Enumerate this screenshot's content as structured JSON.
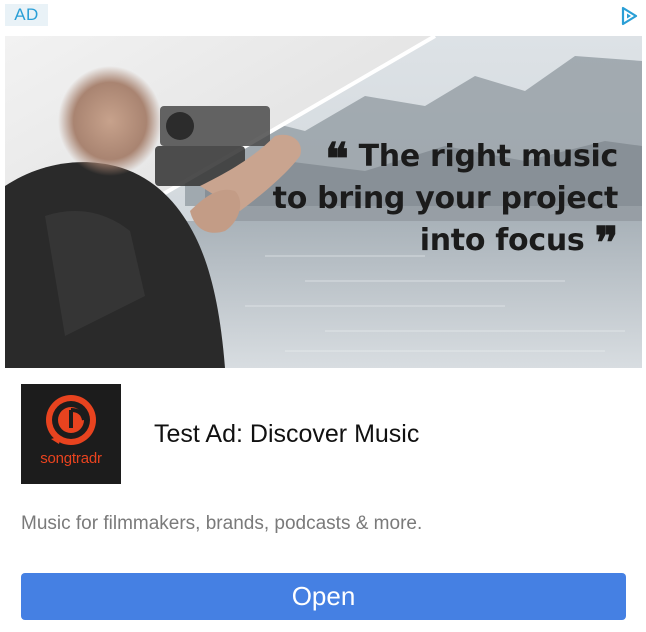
{
  "ad_badge": {
    "label": "AD"
  },
  "adchoices": {
    "icon": "adchoices-icon"
  },
  "hero": {
    "quote_open": "❝",
    "quote_line1": "The right music",
    "quote_line2": "to bring your project",
    "quote_line3": "into focus",
    "quote_close": "❞"
  },
  "advertiser": {
    "logo_text": "songtradr",
    "headline": "Test Ad: Discover Music"
  },
  "body": {
    "text": "Music for filmmakers, brands, podcasts & more."
  },
  "cta": {
    "label": "Open"
  },
  "colors": {
    "badge_text": "#2a9fd6",
    "badge_bg": "#e9f2f7",
    "button": "#4580e3",
    "logo_bg": "#1c1c1c",
    "logo_accent": "#e8431f"
  }
}
